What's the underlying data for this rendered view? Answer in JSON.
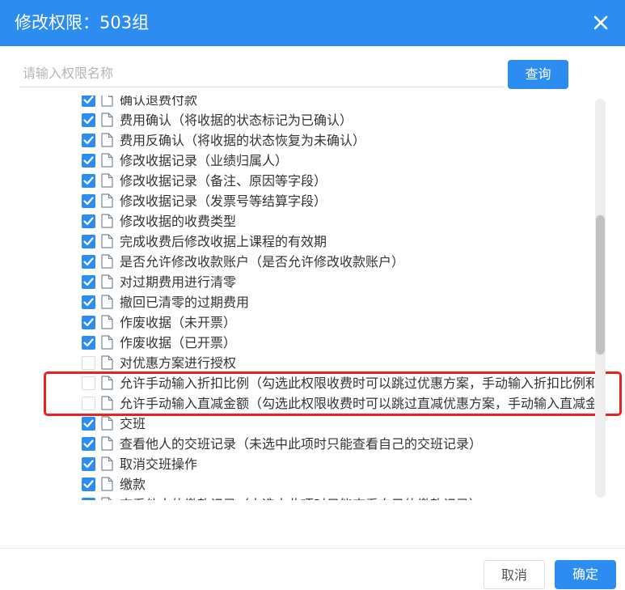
{
  "dialog": {
    "title": "修改权限：503组",
    "close_icon": "close-icon"
  },
  "search": {
    "placeholder": "请输入权限名称",
    "value": "",
    "button_label": "查询"
  },
  "tree": {
    "items": [
      {
        "label": "确认退费付款",
        "checked": true
      },
      {
        "label": "费用确认（将收据的状态标记为已确认）",
        "checked": true
      },
      {
        "label": "费用反确认（将收据的状态恢复为未确认）",
        "checked": true
      },
      {
        "label": "修改收据记录（业绩归属人）",
        "checked": true
      },
      {
        "label": "修改收据记录（备注、原因等字段）",
        "checked": true
      },
      {
        "label": "修改收据记录（发票号等结算字段）",
        "checked": true
      },
      {
        "label": "修改收据的收费类型",
        "checked": true
      },
      {
        "label": "完成收费后修改收据上课程的有效期",
        "checked": true
      },
      {
        "label": "是否允许修改收款账户（是否允许修改收款账户）",
        "checked": true
      },
      {
        "label": "对过期费用进行清零",
        "checked": true
      },
      {
        "label": "撤回已清零的过期费用",
        "checked": true
      },
      {
        "label": "作废收据（未开票）",
        "checked": true
      },
      {
        "label": "作废收据（已开票）",
        "checked": true
      },
      {
        "label": "对优惠方案进行授权",
        "checked": false
      },
      {
        "label": "允许手动输入折扣比例（勾选此权限收费时可以跳过优惠方案，手动输入折扣比例和",
        "checked": false
      },
      {
        "label": "允许手动输入直减金额（勾选此权限收费时可以跳过直减优惠方案，手动输入直减金",
        "checked": false
      },
      {
        "label": "交班",
        "checked": true
      },
      {
        "label": "查看他人的交班记录（未选中此项时只能查看自己的交班记录）",
        "checked": true
      },
      {
        "label": "取消交班操作",
        "checked": true
      },
      {
        "label": "缴款",
        "checked": true
      },
      {
        "label": "查看他人的缴款记录（未选中此项时只能查看自己的缴款记录）",
        "checked": true
      }
    ]
  },
  "footer": {
    "cancel_label": "取消",
    "confirm_label": "确定"
  },
  "colors": {
    "accent": "#2d8cf0",
    "highlight": "#e8221d"
  }
}
